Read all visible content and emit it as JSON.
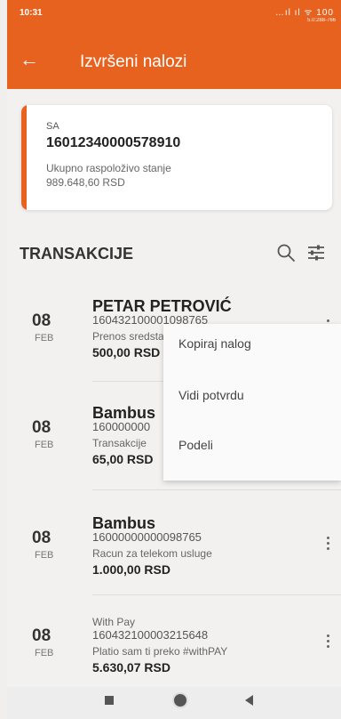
{
  "status": {
    "time": "10:31",
    "icons": "…ıl ıl ᯤ 100",
    "sub": "5.0:288-766"
  },
  "header": {
    "title": "Izvršeni nalozi"
  },
  "account": {
    "label": "SA",
    "number": "16012340000578910",
    "balance_label": "Ukupno raspoloživo stanje",
    "balance": "989.648,60 RSD"
  },
  "section": {
    "title": "TRANSAKCIJE"
  },
  "transactions": [
    {
      "day": "08",
      "month": "FEB",
      "name": "PETAR PETROVIĆ",
      "account": "160432100001098765",
      "description": "Prenos sredstava",
      "amount": "500,00 RSD"
    },
    {
      "day": "08",
      "month": "FEB",
      "name": "Bambus",
      "account": "160000000",
      "description": "Transakcije",
      "amount": "65,00 RSD"
    },
    {
      "day": "08",
      "month": "FEB",
      "name": "Bambus",
      "account": "16000000000098765",
      "description": "Racun za telekom usluge",
      "amount": "1.000,00 RSD"
    },
    {
      "day": "08",
      "month": "FEB",
      "name": "With Pay",
      "account": "160432100003215648",
      "description": "Platio sam ti preko #withPAY",
      "amount": "5.630,07 RSD"
    }
  ],
  "menu": {
    "items": [
      "Kopiraj nalog",
      "Vidi potvrdu",
      "Podeli"
    ]
  },
  "colors": {
    "accent": "#e8621f"
  }
}
